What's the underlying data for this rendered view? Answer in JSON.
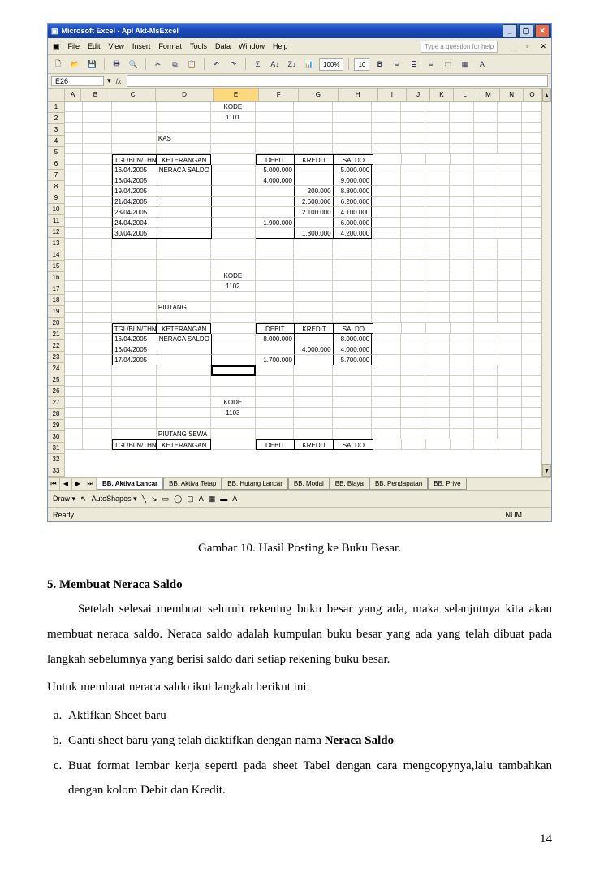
{
  "excel": {
    "title": "Microsoft Excel - Apl Akt-MsExcel",
    "menus": [
      "File",
      "Edit",
      "View",
      "Insert",
      "Format",
      "Tools",
      "Data",
      "Window",
      "Help"
    ],
    "help_placeholder": "Type a question for help",
    "zoom": "100%",
    "font_size": "10",
    "namebox": "E26",
    "columns": [
      "A",
      "B",
      "C",
      "D",
      "E",
      "F",
      "G",
      "H",
      "I",
      "J",
      "K",
      "L",
      "M",
      "N",
      "O"
    ],
    "selected_col": "E",
    "row_count": 33,
    "selected_cell_row": 26,
    "ledger1": {
      "kode_label": "KODE",
      "kode": "1101",
      "name": "KAS",
      "headers": [
        "TGL/BLN/THN",
        "KETERANGAN",
        "DEBIT",
        "KREDIT",
        "SALDO"
      ],
      "rows": [
        {
          "tgl": "16/04/2005",
          "ket": "NERACA SALDO",
          "debit": "5.000.000",
          "kredit": "",
          "saldo": "5.000.000"
        },
        {
          "tgl": "16/04/2005",
          "ket": "",
          "debit": "4.000.000",
          "kredit": "",
          "saldo": "9.000.000"
        },
        {
          "tgl": "19/04/2005",
          "ket": "",
          "debit": "",
          "kredit": "200.000",
          "saldo": "8.800.000"
        },
        {
          "tgl": "21/04/2005",
          "ket": "",
          "debit": "",
          "kredit": "2.600.000",
          "saldo": "6.200.000"
        },
        {
          "tgl": "23/04/2005",
          "ket": "",
          "debit": "",
          "kredit": "2.100.000",
          "saldo": "4.100.000"
        },
        {
          "tgl": "24/04/2004",
          "ket": "",
          "debit": "1.900.000",
          "kredit": "",
          "saldo": "6.000.000"
        },
        {
          "tgl": "30/04/2005",
          "ket": "",
          "debit": "",
          "kredit": "1.800.000",
          "saldo": "4.200.000"
        }
      ]
    },
    "ledger2": {
      "kode_label": "KODE",
      "kode": "1102",
      "name": "PIUTANG",
      "headers": [
        "TGL/BLN/THN",
        "KETERANGAN",
        "DEBIT",
        "KREDIT",
        "SALDO"
      ],
      "rows": [
        {
          "tgl": "16/04/2005",
          "ket": "NERACA SALDO",
          "debit": "8.000.000",
          "kredit": "",
          "saldo": "8.000.000"
        },
        {
          "tgl": "16/04/2005",
          "ket": "",
          "debit": "",
          "kredit": "4.000.000",
          "saldo": "4.000.000"
        },
        {
          "tgl": "17/04/2005",
          "ket": "",
          "debit": "1.700.000",
          "kredit": "",
          "saldo": "5.700.000"
        }
      ]
    },
    "ledger3": {
      "kode_label": "KODE",
      "kode": "1103",
      "name": "PIUTANG SEWA",
      "headers": [
        "TGL/BLN/THN",
        "KETERANGAN",
        "DEBIT",
        "KREDIT",
        "SALDO"
      ]
    },
    "tabs": [
      "BB. Aktiva Lancar",
      "BB. Aktiva Tetap",
      "BB. Hutang Lancar",
      "BB. Modal",
      "BB. Biaya",
      "BB. Pendapatan",
      "BB. Prive"
    ],
    "active_tab": 0,
    "draw_label": "Draw ▾",
    "autoshapes_label": "AutoShapes ▾",
    "status_ready": "Ready",
    "status_num": "NUM"
  },
  "doc": {
    "caption": "Gambar 10. Hasil Posting ke Buku Besar.",
    "section_no": "5.",
    "section_title": "Membuat Neraca Saldo",
    "para1": "Setelah selesai membuat seluruh rekening buku besar yang ada, maka selanjutnya kita akan membuat neraca saldo. Neraca saldo adalah kumpulan buku besar yang ada yang telah dibuat pada langkah sebelumnya yang berisi saldo dari setiap rekening buku besar.",
    "para2": "Untuk membuat neraca saldo ikut langkah berikut ini:",
    "steps": [
      "Aktifkan Sheet baru",
      "Ganti sheet baru yang telah diaktifkan dengan nama ",
      "Buat format lembar kerja seperti pada sheet Tabel dengan cara mengcopynya,lalu tambahkan dengan kolom Debit dan Kredit."
    ],
    "step_b_bold": "Neraca Saldo",
    "page_number": "14"
  }
}
